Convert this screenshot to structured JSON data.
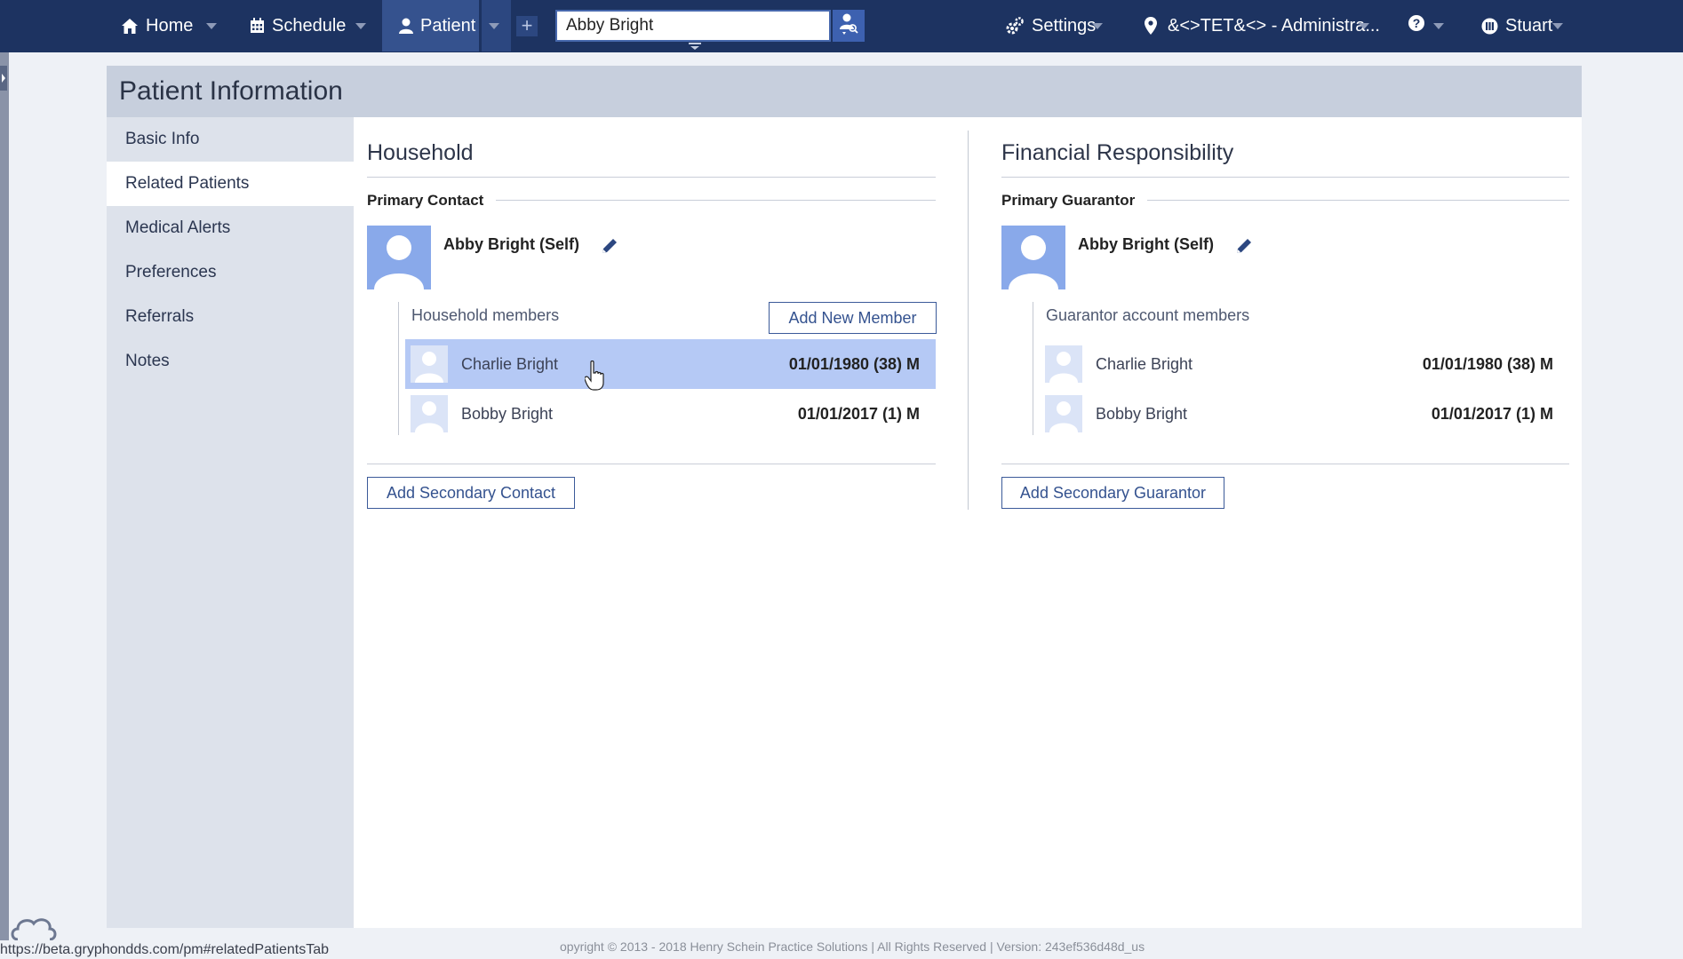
{
  "nav": {
    "home": "Home",
    "schedule": "Schedule",
    "patient": "Patient",
    "search_value": "Abby Bright",
    "settings": "Settings",
    "location": "&<>TET&<> - Administra...",
    "user": "Stuart"
  },
  "panel": {
    "title": "Patient Information"
  },
  "sidebar": {
    "items": [
      {
        "label": "Basic Info",
        "active": false
      },
      {
        "label": "Related Patients",
        "active": true
      },
      {
        "label": "Medical Alerts",
        "active": false
      },
      {
        "label": "Preferences",
        "active": false
      },
      {
        "label": "Referrals",
        "active": false
      },
      {
        "label": "Notes",
        "active": false
      }
    ]
  },
  "household": {
    "title": "Household",
    "primary_label": "Primary Contact",
    "primary_name": "Abby Bright (Self)",
    "members_label": "Household members",
    "add_member": "Add New Member",
    "members": [
      {
        "name": "Charlie Bright",
        "dob": "01/01/1980 (38) M",
        "selected": true
      },
      {
        "name": "Bobby Bright",
        "dob": "01/01/2017 (1) M",
        "selected": false
      }
    ],
    "add_secondary": "Add Secondary Contact"
  },
  "financial": {
    "title": "Financial Responsibility",
    "primary_label": "Primary Guarantor",
    "primary_name": "Abby Bright (Self)",
    "members_label": "Guarantor account members",
    "members": [
      {
        "name": "Charlie Bright",
        "dob": "01/01/1980 (38) M"
      },
      {
        "name": "Bobby Bright",
        "dob": "01/01/2017 (1) M"
      }
    ],
    "add_secondary": "Add Secondary Guarantor"
  },
  "footer": {
    "status_url": "https://beta.gryphondds.com/pm#relatedPatientsTab",
    "copyright": "opyright © 2013 - 2018 Henry Schein Practice Solutions | All Rights Reserved | Version: 243ef536d48d_us"
  },
  "colors": {
    "nav_bg": "#1d3361",
    "accent": "#3d61b0",
    "selected_row": "#b5c9f5",
    "avatar": "#89a9ea"
  }
}
